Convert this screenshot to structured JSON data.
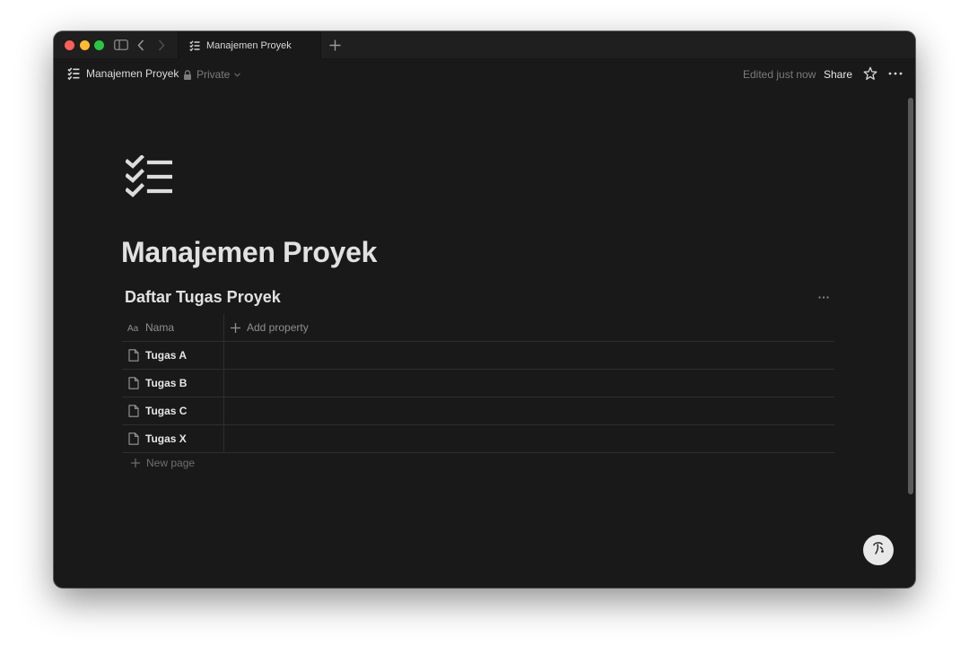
{
  "tab": {
    "title": "Manajemen Proyek"
  },
  "topbar": {
    "page_title": "Manajemen Proyek",
    "privacy": "Private",
    "edited": "Edited just now",
    "share": "Share"
  },
  "page": {
    "title": "Manajemen Proyek"
  },
  "database": {
    "title": "Daftar Tugas Proyek",
    "column_name": "Nama",
    "add_property": "Add property",
    "rows": [
      {
        "name": "Tugas A"
      },
      {
        "name": "Tugas B"
      },
      {
        "name": "Tugas C"
      },
      {
        "name": "Tugas X"
      }
    ],
    "new_page": "New page"
  },
  "icons": {
    "page": "checklist-icon",
    "row": "document-icon",
    "favorite": "star-icon",
    "more": "ellipsis-icon",
    "help": "help-icon"
  },
  "colors": {
    "background": "#191919",
    "text": "#e1e1e1",
    "muted": "#7d7d7d",
    "close": "#ff5f57",
    "minimize": "#febc2e",
    "zoom": "#28c840"
  }
}
